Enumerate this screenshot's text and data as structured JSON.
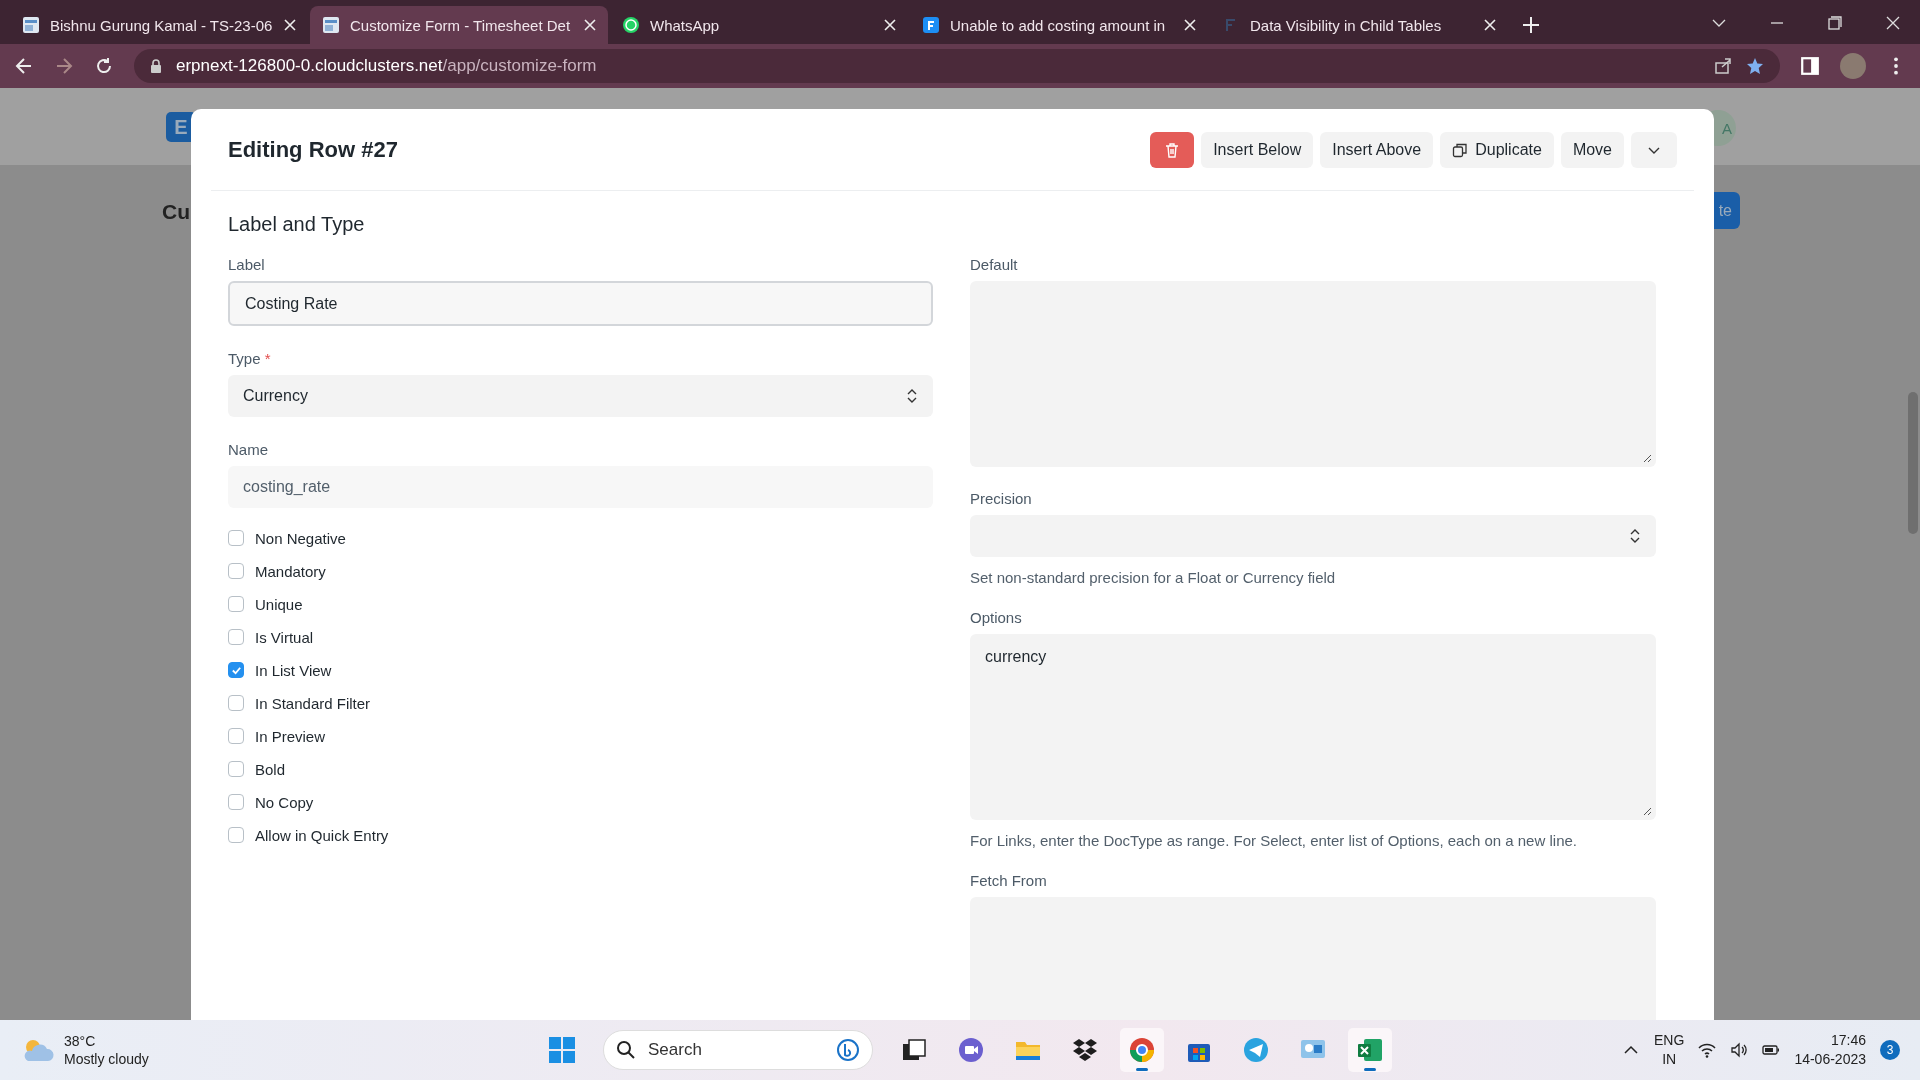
{
  "browser": {
    "tabs": [
      {
        "kind": "page",
        "title": "Bishnu Gurung Kamal - TS-23-06",
        "selected": false
      },
      {
        "kind": "page",
        "title": "Customize Form - Timesheet Det",
        "selected": true
      },
      {
        "kind": "chat",
        "title": "WhatsApp",
        "selected": false
      },
      {
        "kind": "tile",
        "title": "Unable to add costing amount in",
        "selected": false
      },
      {
        "kind": "mark",
        "title": "Data Visibility in Child Tables",
        "selected": false
      }
    ],
    "url": {
      "host": "erpnext-126800-0.cloudclusters.net",
      "path": "/app/customize-form"
    }
  },
  "background": {
    "logo": "E",
    "title_fragment": "Cu",
    "button_fragment": "te",
    "avatar_fragment": "A"
  },
  "dialog": {
    "title": "Editing Row #27",
    "actions": [
      {
        "kind": "delete"
      },
      {
        "kind": "text",
        "label": "Insert Below"
      },
      {
        "kind": "text",
        "label": "Insert Above"
      },
      {
        "kind": "copy",
        "label": "Duplicate"
      },
      {
        "kind": "text",
        "label": "Move"
      },
      {
        "kind": "menu"
      }
    ],
    "section": "Label and Type",
    "left_fields": [
      {
        "kind": "input",
        "label": "Label",
        "value": "Costing Rate"
      },
      {
        "kind": "select",
        "label": "Type",
        "required_mark": "*",
        "value": "Currency"
      },
      {
        "kind": "readonly",
        "label": "Name",
        "value": "costing_rate"
      }
    ],
    "checkboxes": [
      {
        "label": "Non Negative",
        "checked": false
      },
      {
        "label": "Mandatory",
        "checked": false
      },
      {
        "label": "Unique",
        "checked": false
      },
      {
        "label": "Is Virtual",
        "checked": false
      },
      {
        "label": "In List View",
        "checked": true
      },
      {
        "label": "In Standard Filter",
        "checked": false
      },
      {
        "label": "In Preview",
        "checked": false
      },
      {
        "label": "Bold",
        "checked": false
      },
      {
        "label": "No Copy",
        "checked": false
      },
      {
        "label": "Allow in Quick Entry",
        "checked": false
      }
    ],
    "right_fields": [
      {
        "kind": "textarea",
        "label": "Default"
      },
      {
        "kind": "select",
        "label": "Precision",
        "help": "Set non-standard precision for a Float or Currency field"
      },
      {
        "kind": "textarea",
        "label": "Options",
        "value": "currency",
        "help": "For Links, enter the DocType as range. For Select, enter list of Options, each on a new line."
      },
      {
        "kind": "tall",
        "label": "Fetch From"
      }
    ]
  },
  "taskbar": {
    "weather": {
      "temp": "38°C",
      "text": "Mostly cloudy"
    },
    "search": {
      "placeholder": "Search"
    },
    "apps": [
      {
        "kind": "taskview",
        "active": false
      },
      {
        "kind": "meet",
        "active": false
      },
      {
        "kind": "folder",
        "active": false
      },
      {
        "kind": "dropbox",
        "active": false
      },
      {
        "kind": "chrome",
        "active": true
      },
      {
        "kind": "store",
        "active": false
      },
      {
        "kind": "telegram",
        "active": false
      },
      {
        "kind": "monitor",
        "active": false
      },
      {
        "kind": "excel",
        "active": true
      }
    ],
    "language": {
      "line1": "ENG",
      "line2": "IN"
    },
    "time": "17:46",
    "date": "14-06-2023",
    "notifications": "3"
  }
}
